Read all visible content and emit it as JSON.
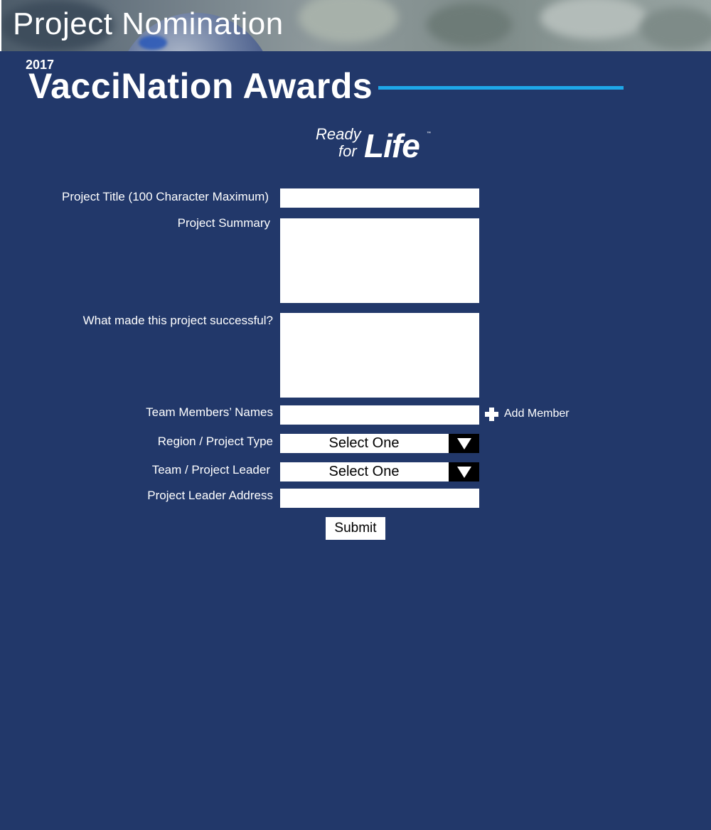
{
  "banner": {
    "title": "Project Nomination"
  },
  "awards": {
    "year": "2017",
    "title": "VacciNation Awards"
  },
  "logo": {
    "ready": "Ready",
    "for": "for",
    "life": "Life",
    "tm": "™"
  },
  "form": {
    "project_title_label": "Project Title (100 Character Maximum)",
    "project_title_value": "",
    "project_summary_label": "Project Summary",
    "project_summary_value": "",
    "success_label": "What made this project successful?",
    "success_value": "",
    "team_members_label": "Team Members’ Names",
    "team_members_value": "",
    "add_member_label": "Add Member",
    "region_label": "Region / Project Type",
    "region_selected": "Select One",
    "leader_label": "Team / Project Leader",
    "leader_selected": "Select One",
    "leader_address_label": "Project Leader Address",
    "leader_address_value": "",
    "submit_label": "Submit"
  },
  "icons": {
    "dropdown": "triangle-down-icon",
    "add": "plus-icon"
  },
  "colors": {
    "background": "#22386a",
    "accent": "#1ea7e8",
    "field": "#ffffff",
    "dropdown_button": "#000000"
  }
}
